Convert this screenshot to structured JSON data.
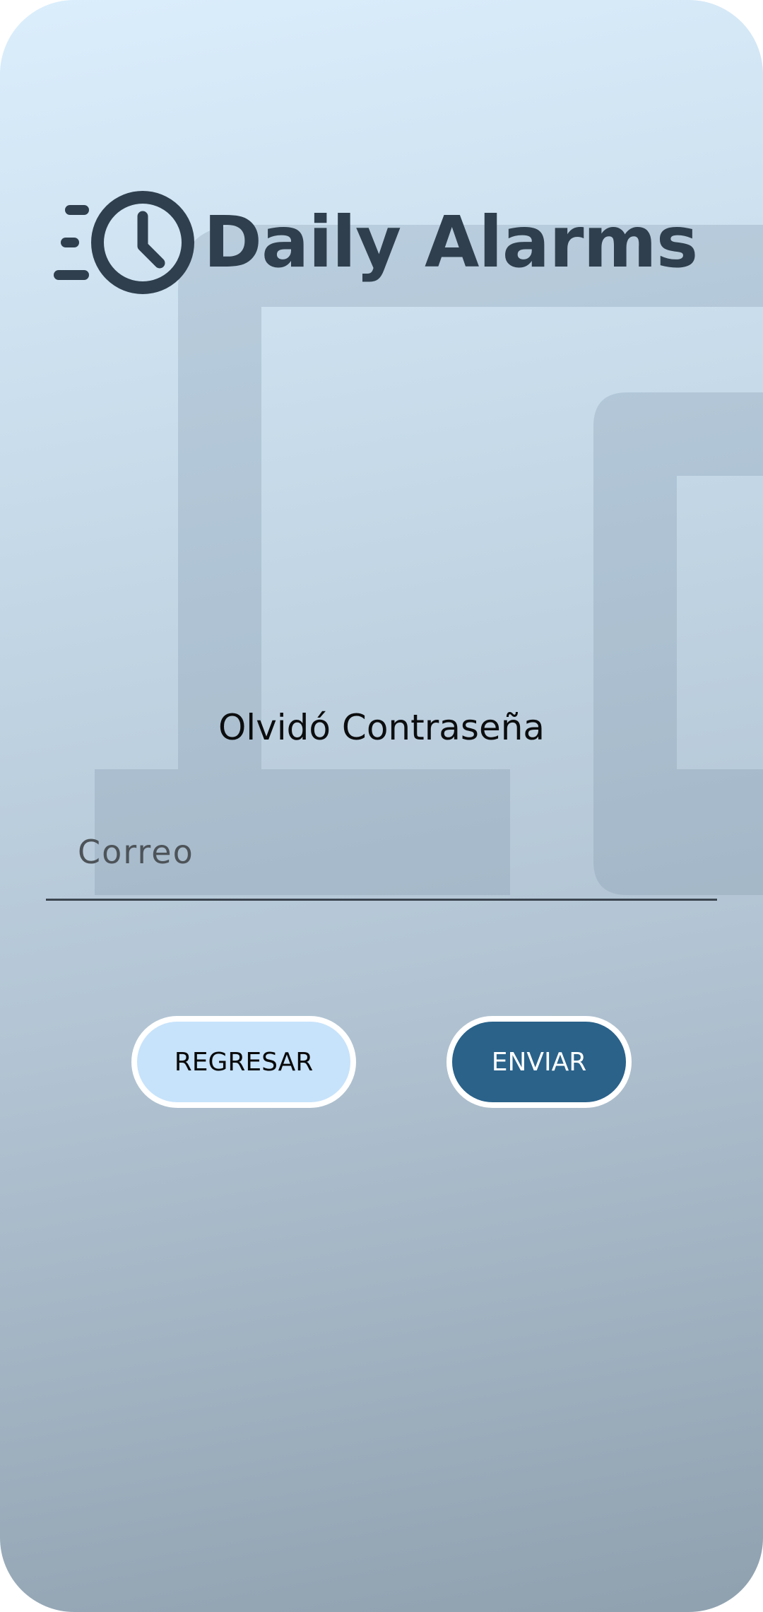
{
  "app": {
    "brand_name": "Daily Alarms",
    "logo_icon": "clock-icon"
  },
  "form": {
    "title": "Olvidó Contraseña",
    "email_placeholder": "Correo",
    "email_value": ""
  },
  "buttons": {
    "back_label": "REGRESAR",
    "send_label": "ENVIAR"
  },
  "colors": {
    "primary": "#2a628a",
    "secondary_button": "#c7e3fb",
    "logo_text": "#2f3f4d"
  }
}
